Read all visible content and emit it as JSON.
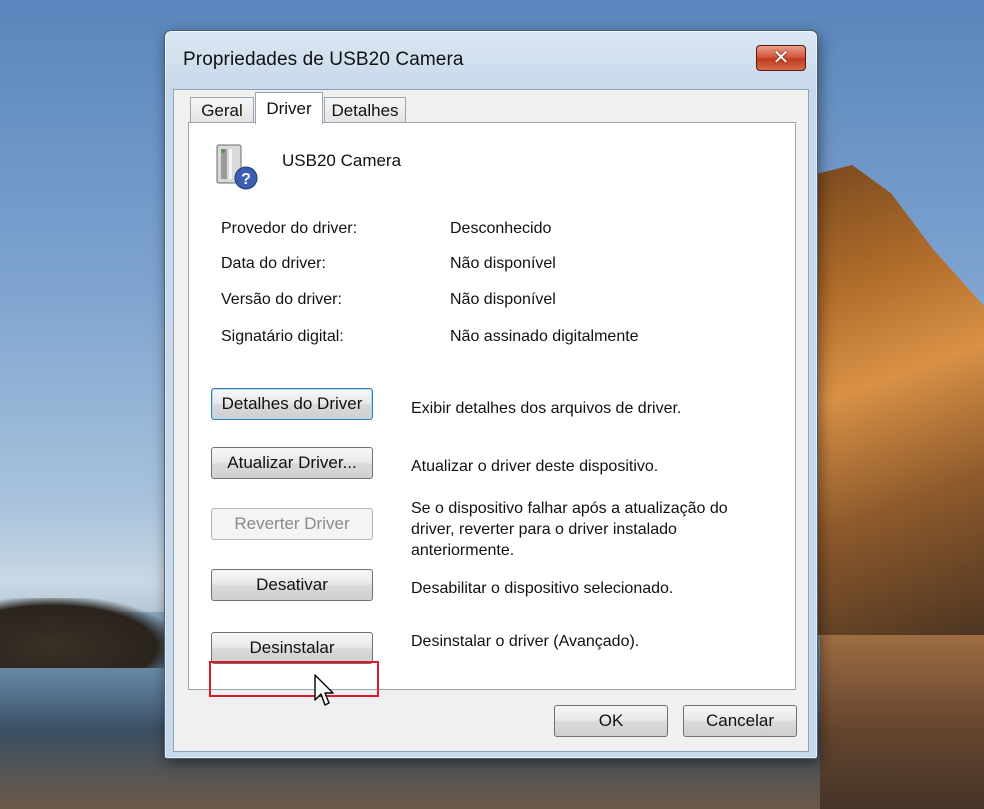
{
  "window": {
    "title": "Propriedades de USB20 Camera",
    "close_label": "✕"
  },
  "tabs": [
    {
      "label": "Geral",
      "active": false
    },
    {
      "label": "Driver",
      "active": true
    },
    {
      "label": "Detalhes",
      "active": false
    }
  ],
  "device": {
    "icon": "usb-device-unknown-icon",
    "name": "USB20 Camera"
  },
  "properties": [
    {
      "label": "Provedor do driver:",
      "value": "Desconhecido"
    },
    {
      "label": "Data do driver:",
      "value": "Não disponível"
    },
    {
      "label": "Versão do driver:",
      "value": "Não disponível"
    },
    {
      "label": "Signatário digital:",
      "value": "Não assinado digitalmente"
    }
  ],
  "actions": [
    {
      "label": "Detalhes do Driver",
      "description": "Exibir detalhes dos arquivos de driver.",
      "enabled": true,
      "focused": true
    },
    {
      "label": "Atualizar Driver...",
      "description": "Atualizar o driver deste dispositivo.",
      "enabled": true
    },
    {
      "label": "Reverter Driver",
      "description": "Se o dispositivo falhar após a atualização do driver, reverter para o driver instalado anteriormente.",
      "description_lines": [
        "Se o dispositivo falhar após a atualização do",
        "driver, reverter para o driver instalado",
        "anteriormente."
      ],
      "enabled": false
    },
    {
      "label": "Desativar",
      "description": "Desabilitar o dispositivo selecionado.",
      "enabled": true
    },
    {
      "label": "Desinstalar",
      "description": "Desinstalar o driver (Avançado).",
      "enabled": true,
      "highlighted": true
    }
  ],
  "footer": {
    "ok_label": "OK",
    "cancel_label": "Cancelar"
  },
  "colors": {
    "highlight": "#e0162b",
    "close_button": "#c03a1f"
  }
}
